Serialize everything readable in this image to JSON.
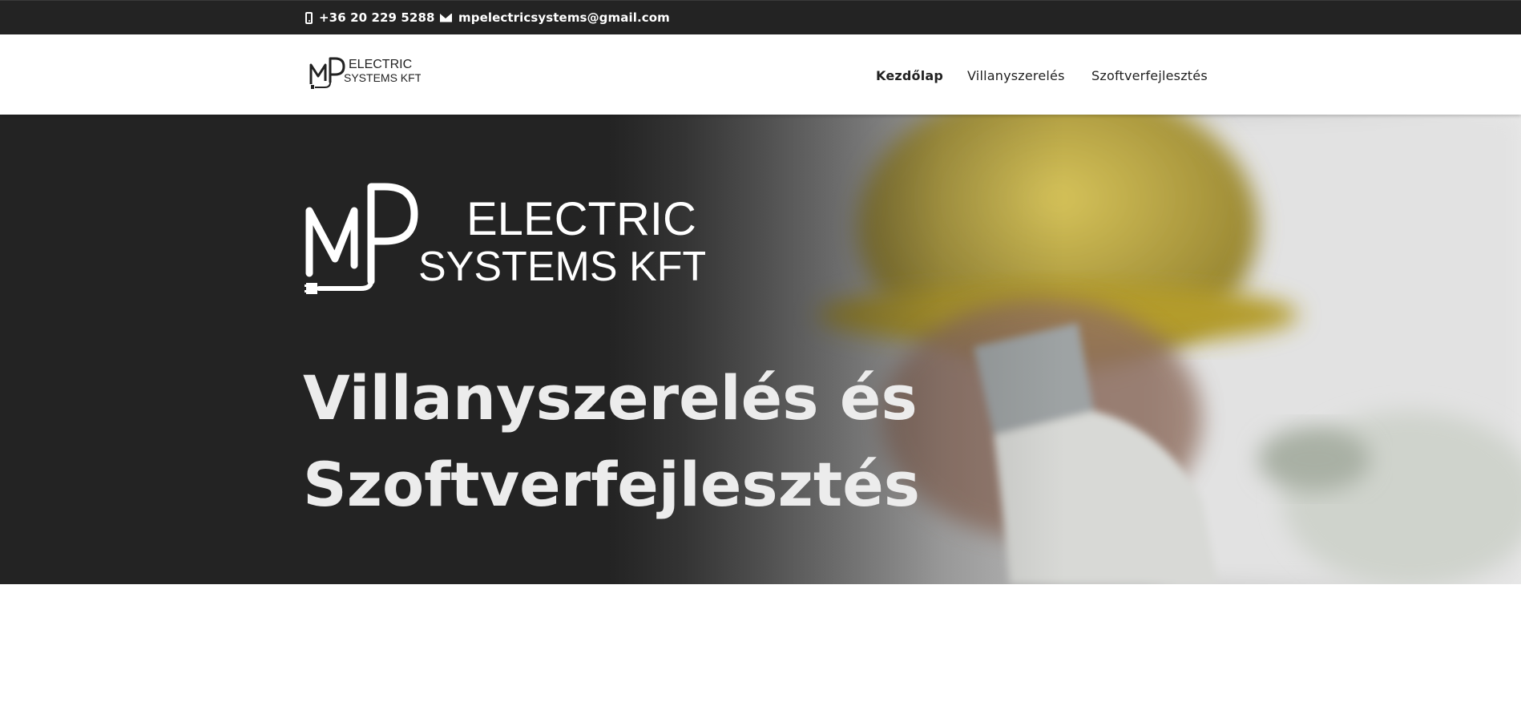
{
  "topbar": {
    "phone": "+36 20 229 5288",
    "email": "mpelectricsystems@gmail.com",
    "phone_icon": "phone-icon",
    "email_icon": "envelope-icon"
  },
  "header": {
    "logo": {
      "monogram": "MP",
      "line1": "ELECTRIC",
      "line2": "SYSTEMS KFT"
    },
    "nav": [
      {
        "label": "Kezdőlap",
        "active": true
      },
      {
        "label": "Villanyszerelés",
        "active": false
      },
      {
        "label": "Szoftverfejlesztés",
        "active": false
      }
    ]
  },
  "hero": {
    "logo": {
      "monogram": "MP",
      "line1": "ELECTRIC",
      "line2": "SYSTEMS KFT"
    },
    "headline_line1": "Villanyszerelés és",
    "headline_line2": "Szoftverfejlesztés"
  },
  "colors": {
    "dark": "#232323",
    "text_light": "#ececec",
    "helmet": "#c9b23e"
  }
}
